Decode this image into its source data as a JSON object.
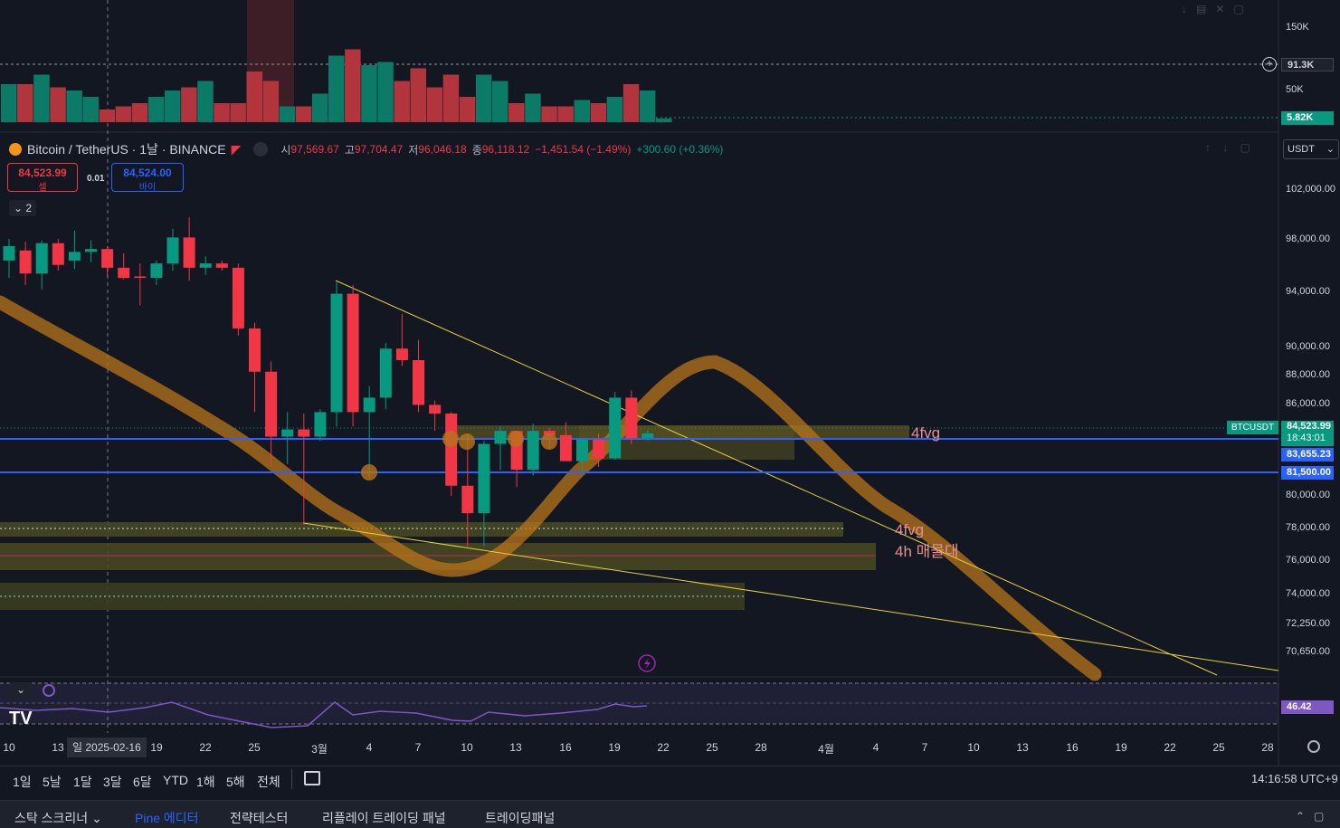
{
  "symbol": {
    "title": "Bitcoin / TetherUS · 1날 · BINANCE",
    "o_label": "시",
    "o": "97,569.67",
    "h_label": "고",
    "h": "97,704.47",
    "l_label": "저",
    "l": "96,046.18",
    "c_label": "종",
    "c": "96,118.12",
    "change": "−1,451.54 (−1.49%)",
    "change2": "+300.60 (+0.36%)"
  },
  "trade": {
    "sell_price": "84,523.99",
    "sell_label": "셀",
    "spread": "0.01",
    "buy_price": "84,524.00",
    "buy_label": "바이",
    "collapse_count": "2"
  },
  "currency_select": "USDT",
  "volume_axis": [
    "150K",
    "91.3K",
    "50K",
    "5.82K"
  ],
  "price_axis": [
    "102,000.00",
    "98,000.00",
    "94,000.00",
    "90,000.00",
    "88,000.00",
    "86,000.00",
    "80,000.00",
    "78,000.00",
    "76,000.00",
    "74,000.00",
    "72,250.00",
    "70,650.00"
  ],
  "price_tags": {
    "symbol_tag": "BTCUSDT",
    "last": "84,523.99",
    "countdown": "18:43:01",
    "line1": "83,655.23",
    "line2": "81,500.00",
    "rsi": "46.42"
  },
  "zone_labels": {
    "z1": "4fvg",
    "z2": "4fvg",
    "z3": "4h 매물대"
  },
  "x_axis": {
    "ticks": [
      "10",
      "13",
      "19",
      "22",
      "25",
      "3월",
      "4",
      "7",
      "10",
      "13",
      "16",
      "19",
      "22",
      "25",
      "28",
      "4월",
      "4",
      "7",
      "10",
      "13",
      "16",
      "19",
      "22",
      "25",
      "28"
    ],
    "crosshair_date": "일 2025-02-16"
  },
  "timeframes": [
    "1일",
    "5날",
    "1달",
    "3달",
    "6달",
    "YTD",
    "1해",
    "5해",
    "전체"
  ],
  "clock": "14:16:58 UTC+9",
  "panels": [
    "스탁 스크리너",
    "Pine 에디터",
    "전략테스터",
    "리플레이 트레이딩 패널",
    "트레이딩패널"
  ],
  "colors": {
    "up": "#089981",
    "down": "#f23645",
    "blue_line": "#2962ff",
    "ma": "#b8741a",
    "trend": "#e6d23a",
    "rsi": "#7e57c2"
  },
  "chart_data": {
    "type": "candlestick",
    "unit": "USDT",
    "ohlc": [
      {
        "o": 96500,
        "h": 98000,
        "l": 95300,
        "c": 97500
      },
      {
        "o": 97200,
        "h": 97800,
        "l": 94800,
        "c": 95600
      },
      {
        "o": 95600,
        "h": 97900,
        "l": 94500,
        "c": 97700
      },
      {
        "o": 97700,
        "h": 98000,
        "l": 95800,
        "c": 96200
      },
      {
        "o": 96500,
        "h": 98600,
        "l": 95900,
        "c": 97100
      },
      {
        "o": 97100,
        "h": 97900,
        "l": 96400,
        "c": 97300
      },
      {
        "o": 97300,
        "h": 97500,
        "l": 95400,
        "c": 96000
      },
      {
        "o": 96000,
        "h": 97000,
        "l": 95200,
        "c": 95300
      },
      {
        "o": 95400,
        "h": 96300,
        "l": 93400,
        "c": 95300
      },
      {
        "o": 95300,
        "h": 96500,
        "l": 94800,
        "c": 96300
      },
      {
        "o": 96300,
        "h": 98700,
        "l": 95800,
        "c": 98100
      },
      {
        "o": 98100,
        "h": 99500,
        "l": 95100,
        "c": 96000
      },
      {
        "o": 96000,
        "h": 96800,
        "l": 95500,
        "c": 96300
      },
      {
        "o": 96300,
        "h": 96500,
        "l": 95800,
        "c": 96000
      },
      {
        "o": 96000,
        "h": 96300,
        "l": 91300,
        "c": 91800
      },
      {
        "o": 91800,
        "h": 92200,
        "l": 86000,
        "c": 88800
      },
      {
        "o": 88800,
        "h": 89500,
        "l": 82300,
        "c": 84300
      },
      {
        "o": 84300,
        "h": 86000,
        "l": 82400,
        "c": 84800
      },
      {
        "o": 84800,
        "h": 85900,
        "l": 78200,
        "c": 84300
      },
      {
        "o": 84300,
        "h": 86200,
        "l": 84000,
        "c": 86000
      },
      {
        "o": 86000,
        "h": 95000,
        "l": 85000,
        "c": 94200
      },
      {
        "o": 94200,
        "h": 94800,
        "l": 85000,
        "c": 86000
      },
      {
        "o": 86000,
        "h": 87800,
        "l": 81500,
        "c": 87000
      },
      {
        "o": 87000,
        "h": 90800,
        "l": 86200,
        "c": 90400
      },
      {
        "o": 90400,
        "h": 92800,
        "l": 89200,
        "c": 89600
      },
      {
        "o": 89600,
        "h": 91000,
        "l": 86000,
        "c": 86500
      },
      {
        "o": 86500,
        "h": 86800,
        "l": 84700,
        "c": 85900
      },
      {
        "o": 85900,
        "h": 86000,
        "l": 80200,
        "c": 80900
      },
      {
        "o": 80900,
        "h": 84500,
        "l": 76700,
        "c": 79000
      },
      {
        "o": 79000,
        "h": 84000,
        "l": 76700,
        "c": 83800
      },
      {
        "o": 83800,
        "h": 85000,
        "l": 82000,
        "c": 84700
      },
      {
        "o": 84700,
        "h": 84700,
        "l": 80800,
        "c": 82000
      },
      {
        "o": 82000,
        "h": 85200,
        "l": 81600,
        "c": 84700
      },
      {
        "o": 84700,
        "h": 84900,
        "l": 83500,
        "c": 84400
      },
      {
        "o": 84400,
        "h": 85300,
        "l": 82700,
        "c": 82600
      },
      {
        "o": 82600,
        "h": 84200,
        "l": 81900,
        "c": 84100
      },
      {
        "o": 84100,
        "h": 84500,
        "l": 82200,
        "c": 82800
      },
      {
        "o": 82800,
        "h": 87400,
        "l": 82700,
        "c": 87000
      },
      {
        "o": 87000,
        "h": 87500,
        "l": 83800,
        "c": 84200
      },
      {
        "o": 84200,
        "h": 84800,
        "l": 84000,
        "c": 84524
      }
    ],
    "volume": [
      60,
      60,
      75,
      55,
      50,
      40,
      20,
      25,
      30,
      40,
      50,
      55,
      65,
      30,
      30,
      80,
      65,
      25,
      25,
      45,
      105,
      115,
      90,
      95,
      65,
      85,
      55,
      75,
      40,
      75,
      65,
      30,
      45,
      25,
      25,
      35,
      30,
      40,
      60,
      50,
      5.82
    ],
    "volume_unit": "K",
    "price_ylim": [
      69000,
      104000
    ],
    "volume_ylim": [
      0,
      160
    ],
    "rsi_last": 46.42
  }
}
